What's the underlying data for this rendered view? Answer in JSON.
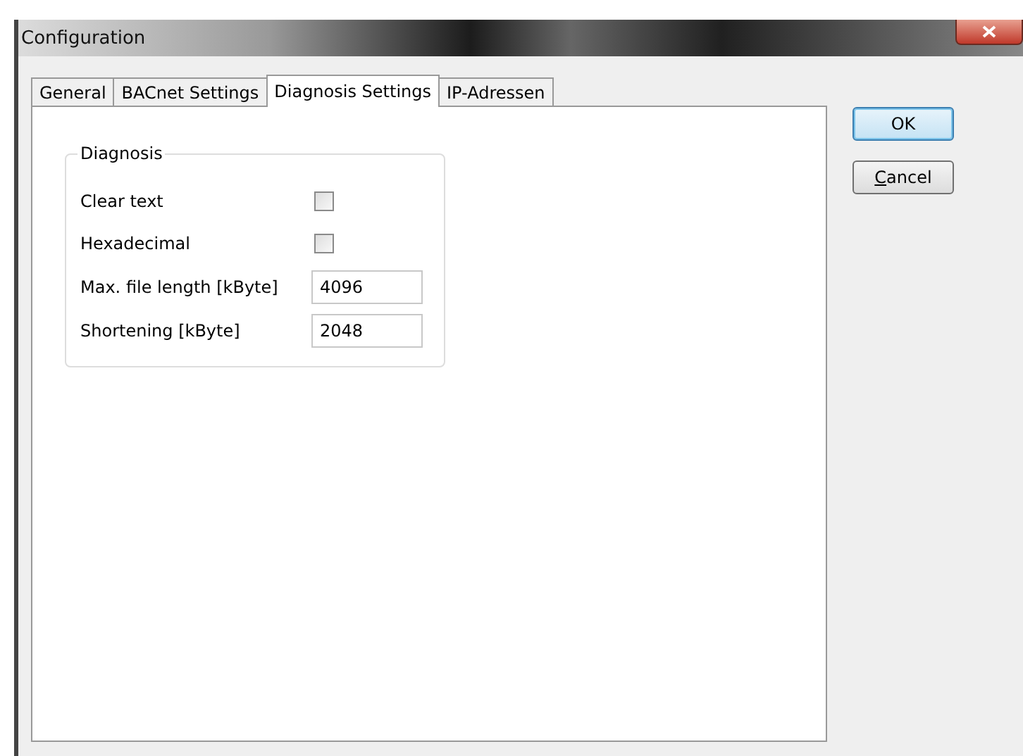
{
  "window": {
    "title": "Configuration"
  },
  "tabs": [
    {
      "label": "General",
      "selected": false
    },
    {
      "label": "BACnet Settings",
      "selected": false
    },
    {
      "label": "Diagnosis Settings",
      "selected": true
    },
    {
      "label": "IP-Adressen",
      "selected": false
    }
  ],
  "group": {
    "title": "Diagnosis",
    "rows": [
      {
        "kind": "checkbox",
        "label": "Clear text",
        "checked": false
      },
      {
        "kind": "checkbox",
        "label": "Hexadecimal",
        "checked": false
      },
      {
        "kind": "text",
        "label": "Max. file length [kByte]",
        "value": "4096"
      },
      {
        "kind": "text",
        "label": "Shortening [kByte]",
        "value": "2048"
      }
    ]
  },
  "buttons": [
    {
      "label": "OK",
      "default": true
    },
    {
      "label": "Cancel",
      "default": false
    }
  ]
}
